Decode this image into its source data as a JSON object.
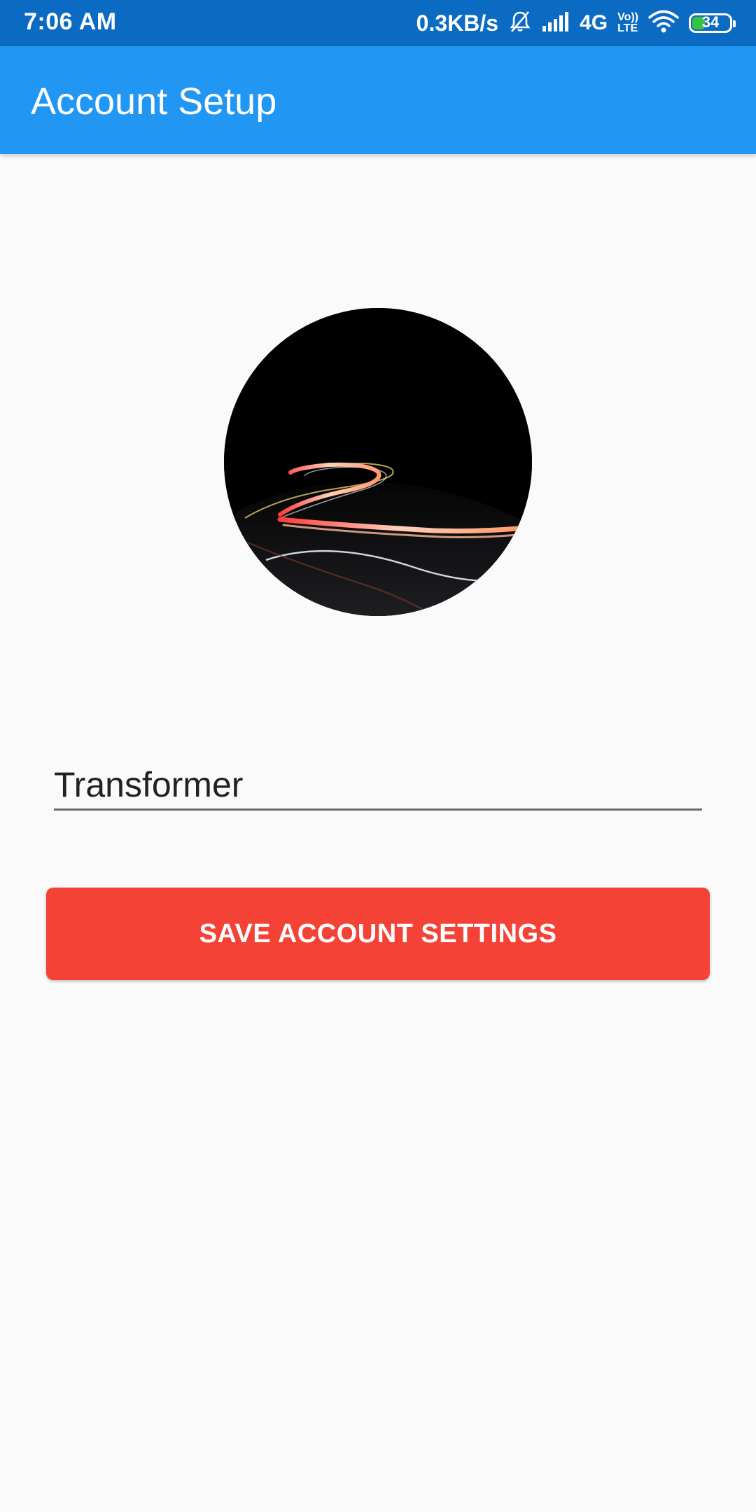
{
  "status_bar": {
    "time": "7:06 AM",
    "net_speed": "0.3KB/s",
    "network_type": "4G",
    "volte_top": "Vo))",
    "volte_bottom": "LTE",
    "battery_level": "34",
    "battery_fraction": 0.34,
    "icons": [
      "mute-icon",
      "signal-icon",
      "wifi-icon",
      "battery-icon"
    ]
  },
  "app_bar": {
    "title": "Account Setup",
    "color": "#2196f3"
  },
  "profile": {
    "avatar_icon": "profile-photo-light-trails"
  },
  "form": {
    "name_value": "Transformer"
  },
  "actions": {
    "save_label": "SAVE ACCOUNT SETTINGS",
    "save_color": "#f44336"
  }
}
